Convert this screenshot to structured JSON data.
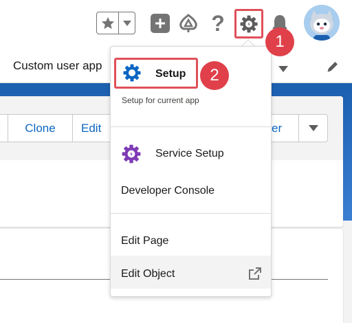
{
  "header": {
    "favorites_icon": "star-icon",
    "favorites_menu_icon": "caret-down-icon",
    "global_actions_icon": "plus-icon",
    "trailhead_icon": "trailhead-icon",
    "help_label": "?",
    "setup_gear_icon": "gear-icon",
    "notifications_icon": "bell-icon",
    "avatar_icon": "avatar"
  },
  "nav": {
    "app_name": "Custom user app",
    "edit_icon": "pencil-icon"
  },
  "record": {
    "actions": [
      "Clone",
      "Edit",
      "er"
    ],
    "more_icon": "caret-down-icon"
  },
  "annotations": {
    "step1": "1",
    "step2": "2"
  },
  "setup_menu": {
    "setup_label": "Setup",
    "setup_description": "Setup for current app",
    "service_setup_label": "Service Setup",
    "developer_console_label": "Developer Console",
    "edit_page_label": "Edit Page",
    "edit_object_label": "Edit Object"
  },
  "colors": {
    "annotation_red": "#e0404a",
    "setup_blue": "#0b66c3",
    "service_purple": "#7f3bb5",
    "header_icon_gray": "#747474",
    "band_blue": "#1b5faf"
  }
}
